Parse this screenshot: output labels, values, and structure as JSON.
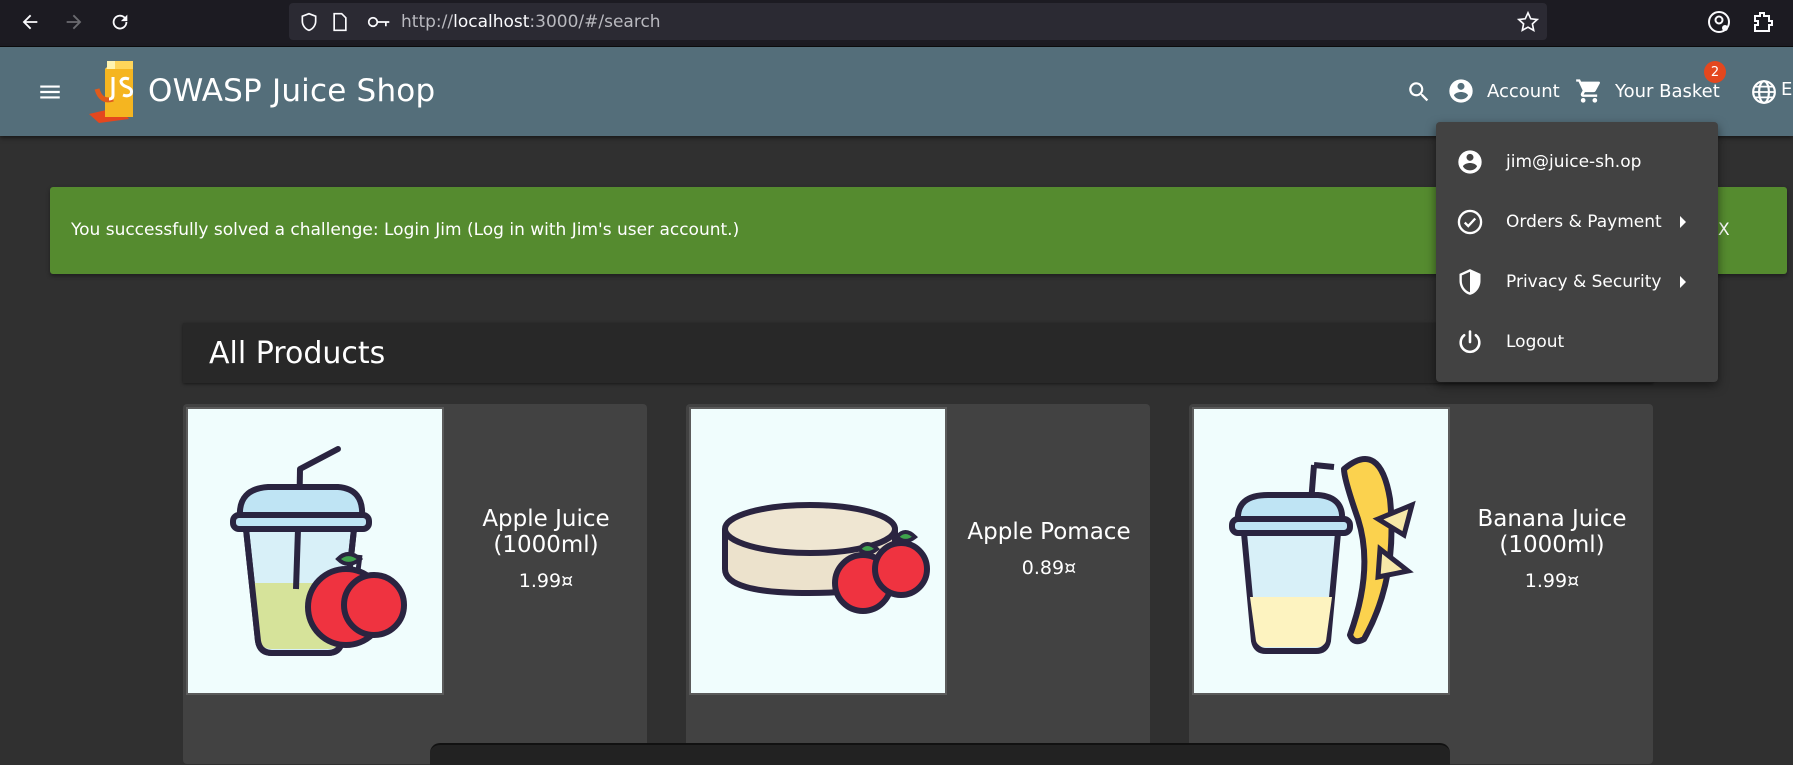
{
  "browser": {
    "url_prefix": "http://",
    "url_host": "localhost",
    "url_rest": ":3000/#/search"
  },
  "toolbar": {
    "title": "OWASP Juice Shop",
    "account_label": "Account",
    "basket_label": "Your Basket",
    "basket_count": "2",
    "language_label": "E"
  },
  "notification": {
    "message": "You successfully solved a challenge: Login Jim (Log in with Jim's user account.)",
    "close_label": "X"
  },
  "products_section": {
    "title": "All Products"
  },
  "products": [
    {
      "name": "Apple Juice (1000ml)",
      "price": "1.99¤"
    },
    {
      "name": "Apple Pomace",
      "price": "0.89¤"
    },
    {
      "name": "Banana Juice (1000ml)",
      "price": "1.99¤"
    }
  ],
  "account_menu": {
    "items": [
      {
        "label": "jim@juice-sh.op",
        "icon": "account-circle-icon"
      },
      {
        "label": "Orders & Payment",
        "icon": "check-circle-icon"
      },
      {
        "label": "Privacy & Security",
        "icon": "shield-icon"
      },
      {
        "label": "Logout",
        "icon": "power-icon"
      }
    ]
  },
  "colors": {
    "toolbar": "#546e7a",
    "snackbar": "#558b2f",
    "background": "#303030",
    "card": "#424242",
    "badge": "#e4471e"
  }
}
